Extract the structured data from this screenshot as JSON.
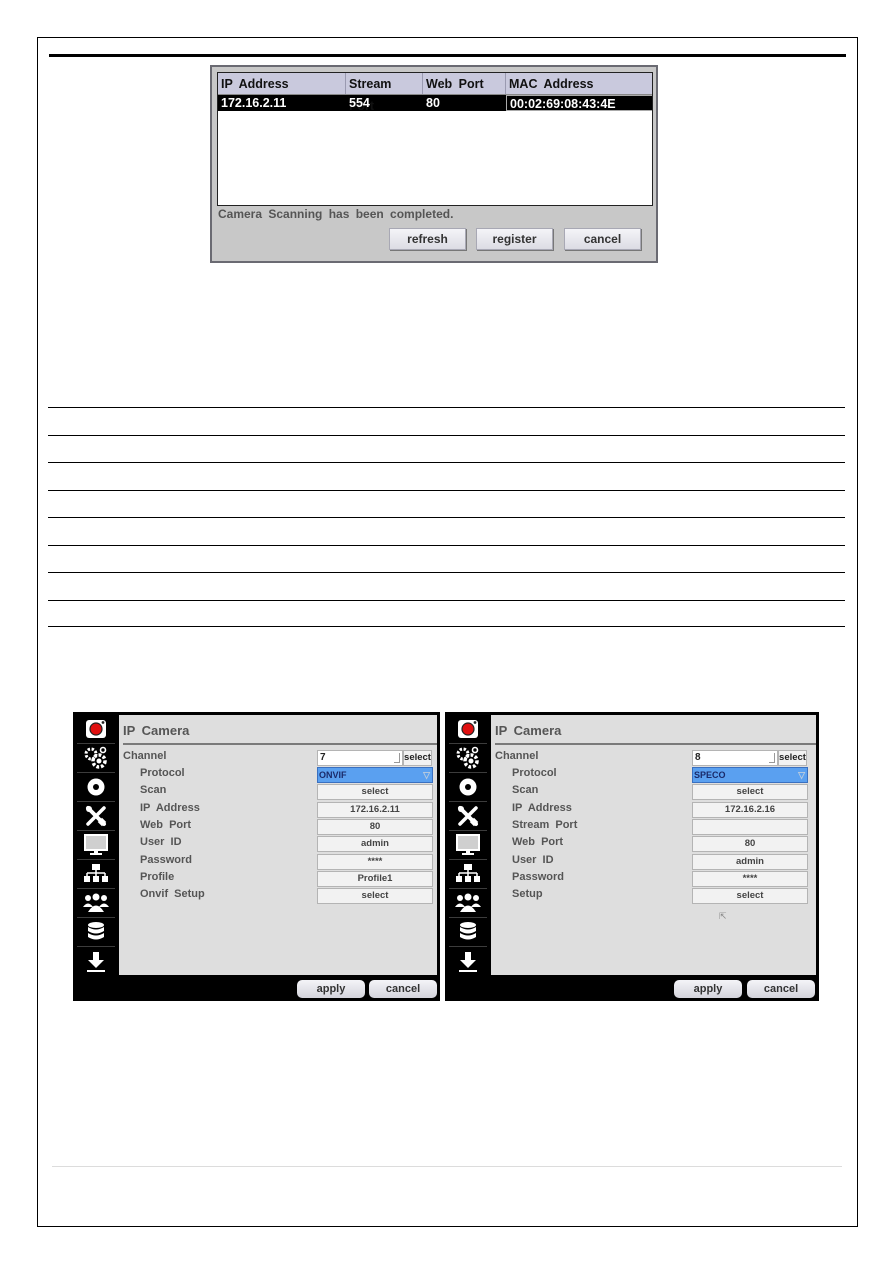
{
  "scan_dialog": {
    "columns": [
      "IP Address",
      "Stream Port",
      "Web Port",
      "MAC Address"
    ],
    "rows": [
      {
        "ip": "172.16.2.11",
        "stream_port": "554",
        "web_port": "80",
        "mac": "00:02:69:08:43:4E"
      }
    ],
    "status": "Camera Scanning has been completed.",
    "buttons": {
      "refresh": "refresh",
      "register": "register",
      "cancel": "cancel"
    }
  },
  "sidebar_icons": [
    "record-icon",
    "settings-gears-icon",
    "disc-icon",
    "tools-icon",
    "monitor-icon",
    "network-icon",
    "users-icon",
    "database-icon",
    "download-icon"
  ],
  "panel_left": {
    "title": "IP Camera",
    "channel_label": "Channel",
    "channel_value": "7",
    "channel_select": "select",
    "fields": [
      {
        "label": "Protocol",
        "value": "ONVIF",
        "type": "dropdown"
      },
      {
        "label": "Scan",
        "value": "select",
        "type": "button"
      },
      {
        "label": "IP Address",
        "value": "172.16.2.11",
        "type": "field"
      },
      {
        "label": "Web Port",
        "value": "80",
        "type": "field"
      },
      {
        "label": "User ID",
        "value": "admin",
        "type": "field"
      },
      {
        "label": "Password",
        "value": "****",
        "type": "field"
      },
      {
        "label": "Profile",
        "value": "Profile1",
        "type": "field"
      },
      {
        "label": "Onvif Setup",
        "value": "select",
        "type": "button"
      }
    ],
    "apply": "apply",
    "cancel": "cancel"
  },
  "panel_right": {
    "title": "IP Camera",
    "channel_label": "Channel",
    "channel_value": "8",
    "channel_select": "select",
    "fields": [
      {
        "label": "Protocol",
        "value": "SPECO",
        "type": "dropdown"
      },
      {
        "label": "Scan",
        "value": "select",
        "type": "button"
      },
      {
        "label": "IP Address",
        "value": "172.16.2.16",
        "type": "field"
      },
      {
        "label": "Stream Port",
        "value": "",
        "type": "field"
      },
      {
        "label": "Web Port",
        "value": "80",
        "type": "field"
      },
      {
        "label": "User ID",
        "value": "admin",
        "type": "field"
      },
      {
        "label": "Password",
        "value": "****",
        "type": "field"
      },
      {
        "label": "Setup",
        "value": "select",
        "type": "button"
      }
    ],
    "apply": "apply",
    "cancel": "cancel"
  }
}
